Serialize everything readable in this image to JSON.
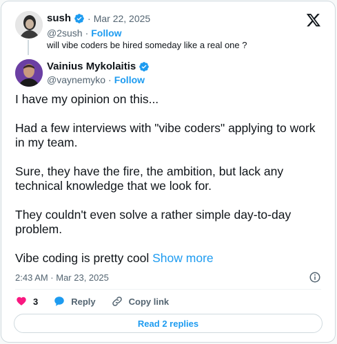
{
  "parent_tweet": {
    "name": "sush",
    "date": "Mar 22, 2025",
    "handle": "@2sush",
    "follow_label": "Follow",
    "text": "will vibe coders be hired someday like a real one ?",
    "avatar_icon": "avatar-photo"
  },
  "main_tweet": {
    "name": "Vainius Mykolaitis",
    "handle": "@vaynemyko",
    "follow_label": "Follow",
    "paragraphs": [
      "I have my opinion on this...",
      "Had a few interviews with \"vibe coders\" applying to work in my team.",
      "Sure, they have the fire, the ambition, but lack any technical knowledge that we look for.",
      "They couldn't even solve a rather simple day-to-day problem."
    ],
    "last_line": "Vibe coding is pretty cool",
    "show_more": "Show more",
    "timestamp": "2:43 AM · Mar 23, 2025"
  },
  "actions": {
    "like_count": "3",
    "reply_label": "Reply",
    "copy_label": "Copy link"
  },
  "read_replies_label": "Read 2 replies",
  "separator": "·",
  "colors": {
    "accent": "#1d9bf0",
    "heart": "#f91880",
    "muted": "#536471"
  }
}
